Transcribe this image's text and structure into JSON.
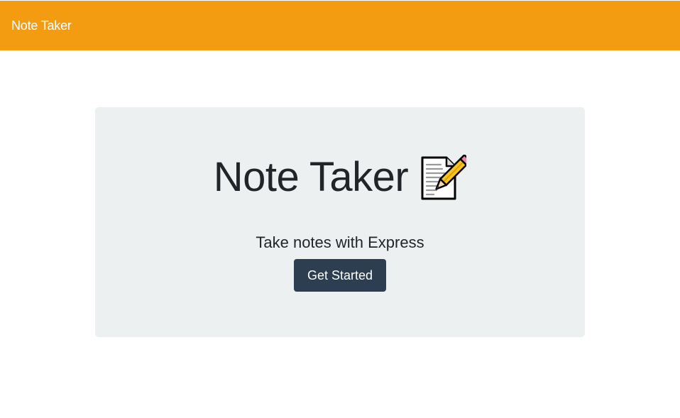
{
  "navbar": {
    "brand": "Note Taker"
  },
  "hero": {
    "title": "Note Taker",
    "title_icon": "memo-icon",
    "subtitle": "Take notes with Express",
    "button_label": "Get Started"
  },
  "colors": {
    "navbar_bg": "#f39c12",
    "hero_bg": "#ecf0f1",
    "button_bg": "#2c3e50",
    "text": "#212529"
  }
}
